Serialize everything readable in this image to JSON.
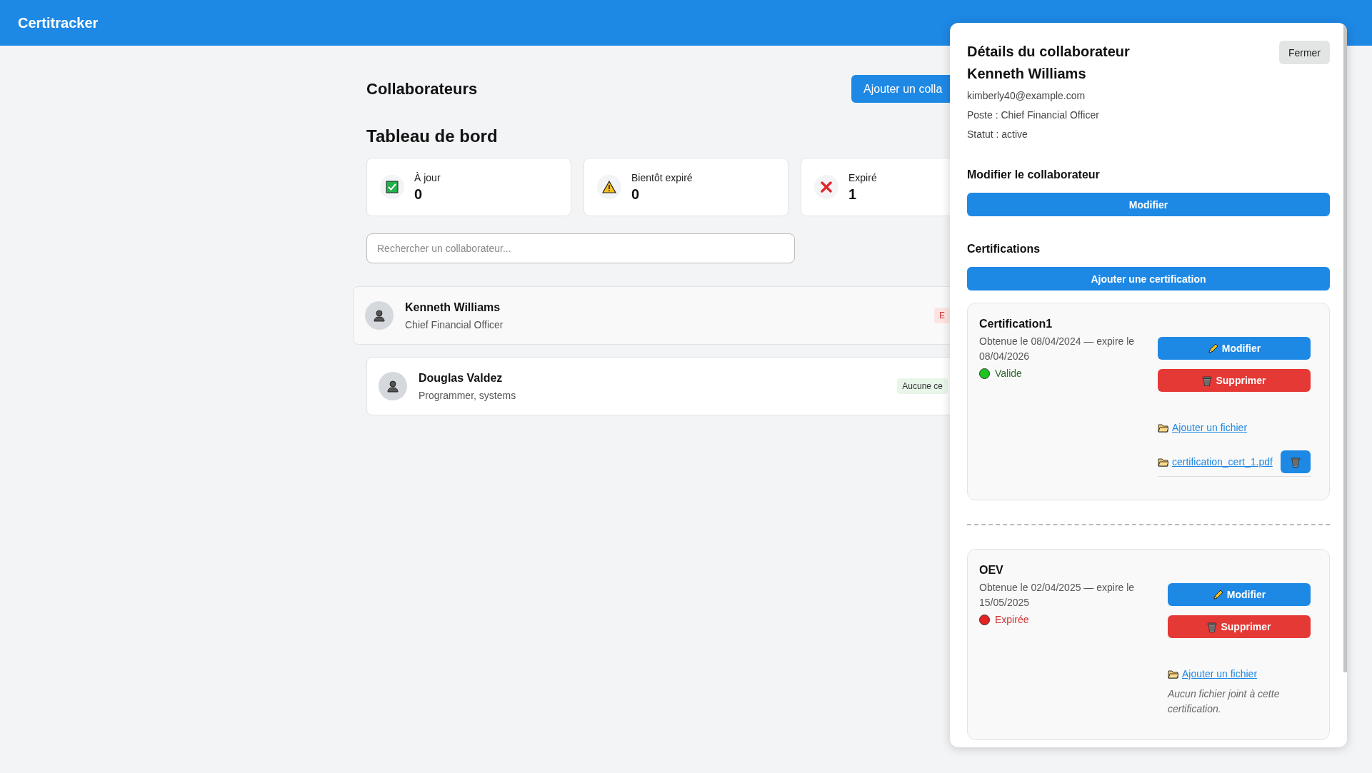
{
  "header": {
    "title": "Certitracker"
  },
  "main": {
    "title": "Collaborateurs",
    "add_button": "Ajouter un colla",
    "dashboard_title": "Tableau de bord",
    "stats": [
      {
        "kind": "ok",
        "label": "À jour",
        "value": "0"
      },
      {
        "kind": "warning",
        "label": "Bientôt expiré",
        "value": "0"
      },
      {
        "kind": "expired",
        "label": "Expiré",
        "value": "1"
      }
    ],
    "search": {
      "placeholder": "Rechercher un collaborateur..."
    },
    "collaborators": [
      {
        "name": "Kenneth Williams",
        "role": "Chief Financial Officer",
        "selected": true,
        "badge": {
          "text": "E",
          "kind": "expired"
        }
      },
      {
        "name": "Douglas Valdez",
        "role": "Programmer, systems",
        "selected": false,
        "badge": {
          "text": "Aucune ce",
          "kind": "none"
        }
      }
    ]
  },
  "panel": {
    "title": "Détails du collaborateur",
    "close_button": "Fermer",
    "name": "Kenneth Williams",
    "email": "kimberly40@example.com",
    "position": "Poste : Chief Financial Officer",
    "status": "Statut : active",
    "edit_section_title": "Modifier le collaborateur",
    "edit_button": "Modifier",
    "certifications_title": "Certifications",
    "add_certification_button": "Ajouter une certification",
    "certifications": [
      {
        "name": "Certification1",
        "dates": "Obtenue le 08/04/2024 — expire le 08/04/2026",
        "status": {
          "label": "Valide",
          "kind": "valid"
        },
        "edit_button": "Modifier",
        "delete_button": "Supprimer",
        "add_file_link": "Ajouter un fichier",
        "files": [
          {
            "name": "certification_cert_1.pdf"
          }
        ]
      },
      {
        "name": "OEV",
        "dates": "Obtenue le 02/04/2025 — expire le 15/05/2025",
        "status": {
          "label": "Expirée",
          "kind": "expired"
        },
        "edit_button": "Modifier",
        "delete_button": "Supprimer",
        "add_file_link": "Ajouter un fichier",
        "empty_files_note": "Aucun fichier joint à cette certification."
      }
    ]
  }
}
